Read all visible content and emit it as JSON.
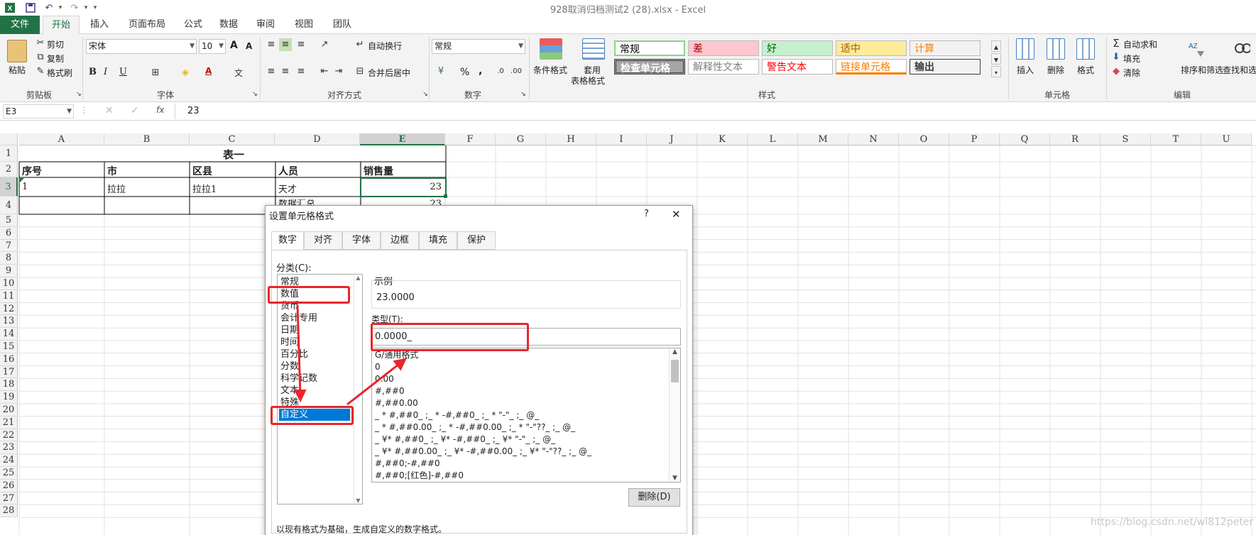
{
  "window": {
    "title": "928取消归档测试2 (28).xlsx - Excel"
  },
  "quick_access": {
    "app_icon": "excel-icon",
    "undo": "↶",
    "redo": "↷",
    "customize": "▾"
  },
  "tabs": [
    "文件",
    "开始",
    "插入",
    "页面布局",
    "公式",
    "数据",
    "审阅",
    "视图",
    "团队"
  ],
  "ribbon": {
    "clipboard": {
      "paste": "粘贴",
      "cut": "剪切",
      "copy": "复制",
      "format_painter": "格式刷",
      "label": "剪贴板"
    },
    "font": {
      "name": "宋体",
      "size": "10",
      "bold": "B",
      "italic": "I",
      "underline": "U",
      "label": "字体",
      "grow": "A",
      "shrink": "A",
      "phonetic": "文"
    },
    "alignment": {
      "wrap": "自动换行",
      "merge": "合并后居中",
      "label": "对齐方式"
    },
    "number": {
      "format": "常规",
      "percent": "%",
      "comma": ",",
      "label": "数字"
    },
    "styles": {
      "conditional": "条件格式",
      "table_line1": "套用",
      "table_line2": "表格格式",
      "cells": [
        {
          "text": "常规",
          "bg": "#ffffff",
          "fg": "#000000"
        },
        {
          "text": "差",
          "bg": "#ffc7ce",
          "fg": "#9c0006"
        },
        {
          "text": "好",
          "bg": "#c6efce",
          "fg": "#006100"
        },
        {
          "text": "适中",
          "bg": "#ffeb9c",
          "fg": "#9c5700"
        },
        {
          "text": "计算",
          "bg": "#f2f2f2",
          "fg": "#fa7d00"
        },
        {
          "text": "检查单元格",
          "bg": "#a5a5a5",
          "fg": "#ffffff"
        },
        {
          "text": "解释性文本",
          "bg": "#ffffff",
          "fg": "#7f7f7f"
        },
        {
          "text": "警告文本",
          "bg": "#ffffff",
          "fg": "#ff0000"
        },
        {
          "text": "链接单元格",
          "bg": "#ffffff",
          "fg": "#fa7d00"
        },
        {
          "text": "输出",
          "bg": "#f2f2f2",
          "fg": "#3f3f3f"
        }
      ],
      "label": "样式"
    },
    "cells": {
      "insert": "插入",
      "delete": "删除",
      "format": "格式",
      "label": "单元格"
    },
    "editing": {
      "autosum": "自动求和",
      "fill": "填充",
      "clear": "清除",
      "sort": "排序和筛选",
      "find": "查找和选择",
      "label": "编辑"
    }
  },
  "formula_bar": {
    "name_box": "E3",
    "fx": "fx",
    "value": "23"
  },
  "sheet": {
    "columns": [
      "A",
      "B",
      "C",
      "D",
      "E",
      "F",
      "G",
      "H",
      "I",
      "J",
      "K",
      "L",
      "M",
      "N",
      "O",
      "P",
      "Q",
      "R",
      "S",
      "T",
      "U"
    ],
    "rows": [
      "1",
      "2",
      "3",
      "4",
      "5",
      "6",
      "7",
      "8",
      "9",
      "10",
      "11",
      "12",
      "13",
      "14",
      "15",
      "16",
      "17",
      "18",
      "19",
      "20",
      "21",
      "22",
      "23",
      "24",
      "25",
      "26",
      "27",
      "28"
    ],
    "title": "表一",
    "headers": [
      "序号",
      "市",
      "区县",
      "人员",
      "销售量"
    ],
    "row3": [
      "1",
      "拉拉",
      "拉拉1",
      "天才",
      "23"
    ],
    "row4_partial": [
      "数据汇总",
      "23"
    ]
  },
  "dialog": {
    "title": "设置单元格格式",
    "help": "?",
    "close": "✕",
    "tabs": [
      "数字",
      "对齐",
      "字体",
      "边框",
      "填充",
      "保护"
    ],
    "category_label": "分类(C):",
    "categories": [
      "常规",
      "数值",
      "货币",
      "会计专用",
      "日期",
      "时间",
      "百分比",
      "分数",
      "科学记数",
      "文本",
      "特殊",
      "自定义"
    ],
    "selected_category": "自定义",
    "sample_label": "示例",
    "sample_value": "23.0000",
    "type_label": "类型(T):",
    "type_value": "0.0000_",
    "formats": [
      "G/通用格式",
      "0",
      "0.00",
      "#,##0",
      "#,##0.00",
      "_ * #,##0_ ;_ * -#,##0_ ;_ * \"-\"_ ;_ @_",
      "_ * #,##0.00_ ;_ * -#,##0.00_ ;_ * \"-\"??_ ;_ @_",
      "_ ¥* #,##0_ ;_ ¥* -#,##0_ ;_ ¥* \"-\"_ ;_ @_",
      "_ ¥* #,##0.00_ ;_ ¥* -#,##0.00_ ;_ ¥* \"-\"??_ ;_ @_",
      "#,##0;-#,##0",
      "#,##0;[红色]-#,##0"
    ],
    "delete_button": "删除(D)",
    "description": "以现有格式为基础，生成自定义的数字格式。"
  },
  "watermark": "https://blog.csdn.net/wl812peter",
  "colors": {
    "excel_green": "#217346",
    "selection_blue": "#0078d7",
    "annotation_red": "#e8262b"
  }
}
